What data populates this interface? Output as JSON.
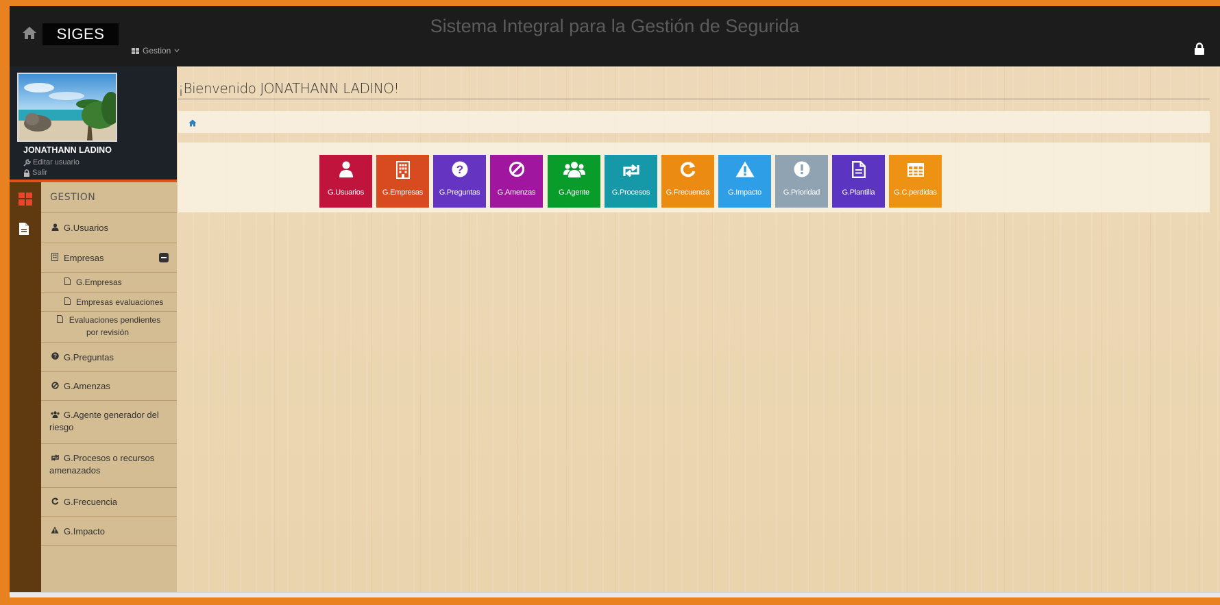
{
  "header": {
    "brand": "SIGES",
    "system_title": "Sistema Integral para la Gestión de Segurida",
    "menu_label": "Gestion"
  },
  "profile": {
    "name": "JONATHANN LADINO",
    "edit_label": "Editar usuario",
    "logout_label": "Salir"
  },
  "sidebar": {
    "section_label": "GESTION",
    "items": [
      {
        "icon": "user-icon",
        "label": "G.Usuarios"
      },
      {
        "icon": "building-icon",
        "label": "Empresas"
      },
      {
        "icon": "file-icon",
        "label": "G.Empresas"
      },
      {
        "icon": "file-icon",
        "label": "Empresas evaluaciones"
      },
      {
        "icon": "file-icon",
        "label": "Evaluaciones pendientes por revisión"
      },
      {
        "icon": "question-icon",
        "label": "G.Preguntas"
      },
      {
        "icon": "ban-icon",
        "label": "G.Amenzas"
      },
      {
        "icon": "users-icon",
        "label": "G.Agente generador del riesgo"
      },
      {
        "icon": "retweet-icon",
        "label": "G.Procesos o recursos amenazados"
      },
      {
        "icon": "refresh-icon",
        "label": "G.Frecuencia"
      },
      {
        "icon": "warning-icon",
        "label": "G.Impacto"
      }
    ]
  },
  "main": {
    "welcome": "¡Bienvenido JONATHANN LADINO!"
  },
  "tiles": [
    {
      "label": "G.Usuarios",
      "icon": "user-icon",
      "color": "#c1143d"
    },
    {
      "label": "G.Empresas",
      "icon": "building-icon",
      "color": "#d84b20"
    },
    {
      "label": "G.Preguntas",
      "icon": "question-icon",
      "color": "#6534c1"
    },
    {
      "label": "G.Amenzas",
      "icon": "ban-icon",
      "color": "#a1169f"
    },
    {
      "label": "G.Agente",
      "icon": "users-icon",
      "color": "#0a9c2a"
    },
    {
      "label": "G.Procesos",
      "icon": "retweet-icon",
      "color": "#1598a8"
    },
    {
      "label": "G.Frecuencia",
      "icon": "refresh-icon",
      "color": "#ec8b12"
    },
    {
      "label": "G.Impacto",
      "icon": "warning-icon",
      "color": "#2e9ee6"
    },
    {
      "label": "G.Prioridad",
      "icon": "exclamation-icon",
      "color": "#8fa3b3"
    },
    {
      "label": "G.Plantilla",
      "icon": "file-icon",
      "color": "#5b34c2"
    },
    {
      "label": "G.C.perdidas",
      "icon": "table-icon",
      "color": "#ee9213"
    }
  ]
}
